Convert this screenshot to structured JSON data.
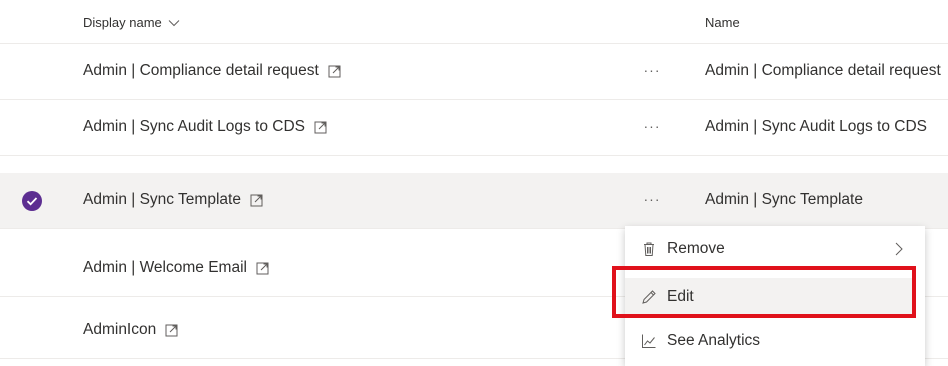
{
  "header": {
    "display_name": "Display name",
    "name": "Name"
  },
  "rows": [
    {
      "display": "Admin | Compliance detail request",
      "name": "Admin | Compliance detail request",
      "selected": false
    },
    {
      "display": "Admin | Sync Audit Logs to CDS",
      "name": "Admin | Sync Audit Logs to CDS",
      "selected": false
    },
    {
      "display": "Admin | Sync Template",
      "name": "Admin | Sync Template",
      "selected": true
    },
    {
      "display": "Admin | Welcome Email",
      "name": "",
      "selected": false
    },
    {
      "display": "AdminIcon",
      "name": "",
      "selected": false
    }
  ],
  "more_glyph": "···",
  "context_menu": {
    "items": [
      {
        "label": "Remove",
        "icon": "trash-icon",
        "has_submenu": true
      },
      {
        "label": "Edit",
        "icon": "pencil-icon",
        "has_submenu": false
      },
      {
        "label": "See Analytics",
        "icon": "analytics-icon",
        "has_submenu": false
      }
    ]
  },
  "colors": {
    "accent": "#5c2e91",
    "highlight_border": "#e0111b",
    "selected_row": "#f3f2f1"
  }
}
